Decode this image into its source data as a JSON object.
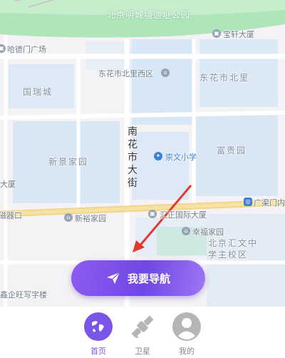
{
  "map": {
    "labels": {
      "park": "北京明城墙遗址公园",
      "baoxuan": "宝轩大厦",
      "hademen_square": "哈德门广场",
      "dhs_beili_west": "东花市北里西区",
      "dhs_beili": "东花市北里",
      "guoruicheng": "国瑞城",
      "street_name": "南花市大街",
      "xinjing": "新景家园",
      "chongwen_school": "崇文小学",
      "fugui": "富贵园",
      "dasha": "大厦",
      "guangqumen": "广渠门内",
      "ciqikou": "磁器口",
      "xinyu": "新裕家园",
      "huizheng": "汇正国际大厦",
      "xingfu": "幸福家园",
      "huiwen": "北京汇文中学主校区",
      "xinqiwang": "鑫企旺写字楼"
    },
    "route_color": "#e03a2f"
  },
  "nav_button": {
    "label": "我要导航"
  },
  "tabs": [
    {
      "id": "home",
      "label": "首页",
      "active": true,
      "icon": "globe-icon",
      "color": "#7a55e8"
    },
    {
      "id": "satellite",
      "label": "卫星",
      "active": false,
      "icon": "satellite-icon",
      "color": "#b5b5b5"
    },
    {
      "id": "mine",
      "label": "我的",
      "active": false,
      "icon": "profile-icon",
      "color": "#b5b5b5"
    }
  ]
}
